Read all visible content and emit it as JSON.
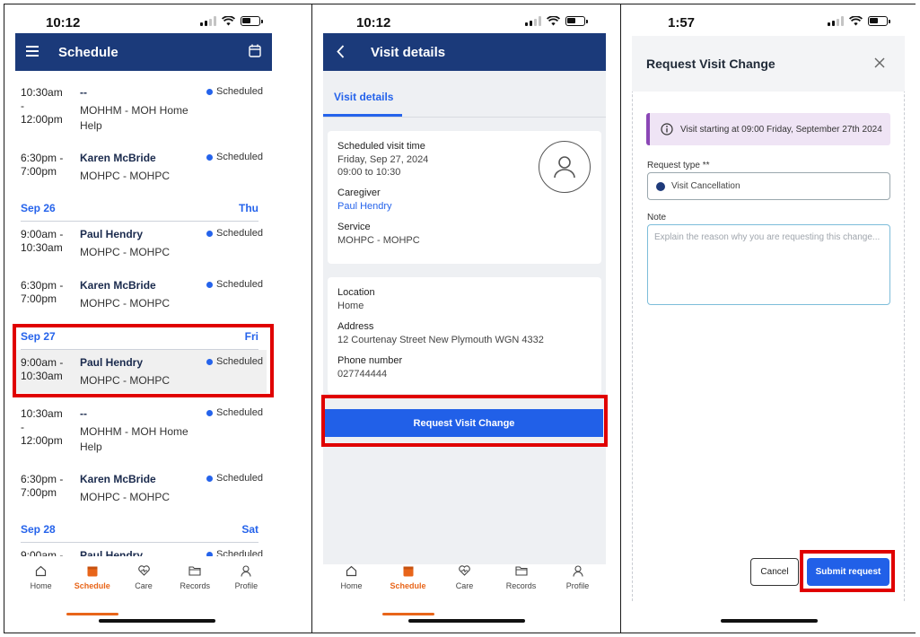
{
  "screens": {
    "schedule": {
      "status_time": "10:12",
      "header_title": "Schedule",
      "visits_top": [
        {
          "time": "10:30am\n-\n12:00pm",
          "caregiver": "--",
          "service": "MOHHM - MOH Home Help",
          "status": "Scheduled"
        },
        {
          "time": "6:30pm -\n7:00pm",
          "caregiver": "Karen McBride",
          "service": "MOHPC - MOHPC",
          "status": "Scheduled"
        }
      ],
      "day_sep26": {
        "date": "Sep 26",
        "dow": "Thu"
      },
      "visits_sep26": [
        {
          "time": "9:00am -\n10:30am",
          "caregiver": "Paul Hendry",
          "service": "MOHPC - MOHPC",
          "status": "Scheduled"
        },
        {
          "time": "6:30pm -\n7:00pm",
          "caregiver": "Karen McBride",
          "service": "MOHPC - MOHPC",
          "status": "Scheduled"
        }
      ],
      "day_sep27": {
        "date": "Sep 27",
        "dow": "Fri"
      },
      "visits_sep27": [
        {
          "time": "9:00am -\n10:30am",
          "caregiver": "Paul Hendry",
          "service": "MOHPC - MOHPC",
          "status": "Scheduled"
        },
        {
          "time": "10:30am\n-\n12:00pm",
          "caregiver": "--",
          "service": "MOHHM - MOH Home Help",
          "status": "Scheduled"
        },
        {
          "time": "6:30pm -\n7:00pm",
          "caregiver": "Karen McBride",
          "service": "MOHPC - MOHPC",
          "status": "Scheduled"
        }
      ],
      "day_sep28": {
        "date": "Sep 28",
        "dow": "Sat"
      },
      "visits_sep28": [
        {
          "time": "9:00am -",
          "caregiver": "Paul Hendry",
          "service": "",
          "status": "Scheduled"
        }
      ]
    },
    "visit_details": {
      "status_time": "10:12",
      "header_title": "Visit details",
      "tab_label": "Visit details",
      "scheduled_visit_time_label": "Scheduled visit time",
      "scheduled_date": "Friday, Sep 27, 2024",
      "scheduled_range": "09:00 to 10:30",
      "caregiver_label": "Caregiver",
      "caregiver_name": "Paul Hendry",
      "service_label": "Service",
      "service_value": "MOHPC - MOHPC",
      "location_label": "Location",
      "location_value": "Home",
      "address_label": "Address",
      "address_value": "12 Courtenay Street New Plymouth WGN 4332",
      "phone_label": "Phone number",
      "phone_value": "027744444",
      "request_button": "Request Visit Change"
    },
    "request_change": {
      "status_time": "1:57",
      "title": "Request Visit Change",
      "info_text": "Visit starting at 09:00 Friday, September 27th 2024",
      "request_type_label": "Request type **",
      "request_type_value": "Visit Cancellation",
      "note_label": "Note",
      "note_placeholder": "Explain the reason why you are requesting this change...",
      "cancel_label": "Cancel",
      "submit_label": "Submit request"
    }
  },
  "bottom_nav": [
    {
      "label": "Home",
      "icon": "home-icon"
    },
    {
      "label": "Schedule",
      "icon": "calendar-icon",
      "active": true
    },
    {
      "label": "Care",
      "icon": "heart-icon"
    },
    {
      "label": "Records",
      "icon": "folder-icon"
    },
    {
      "label": "Profile",
      "icon": "user-icon"
    }
  ],
  "colors": {
    "header_blue": "#1b3a7a",
    "accent_blue": "#2563eb",
    "active_orange": "#e8651a",
    "highlight_red": "#e00000",
    "info_purple": "#8b47b6"
  }
}
